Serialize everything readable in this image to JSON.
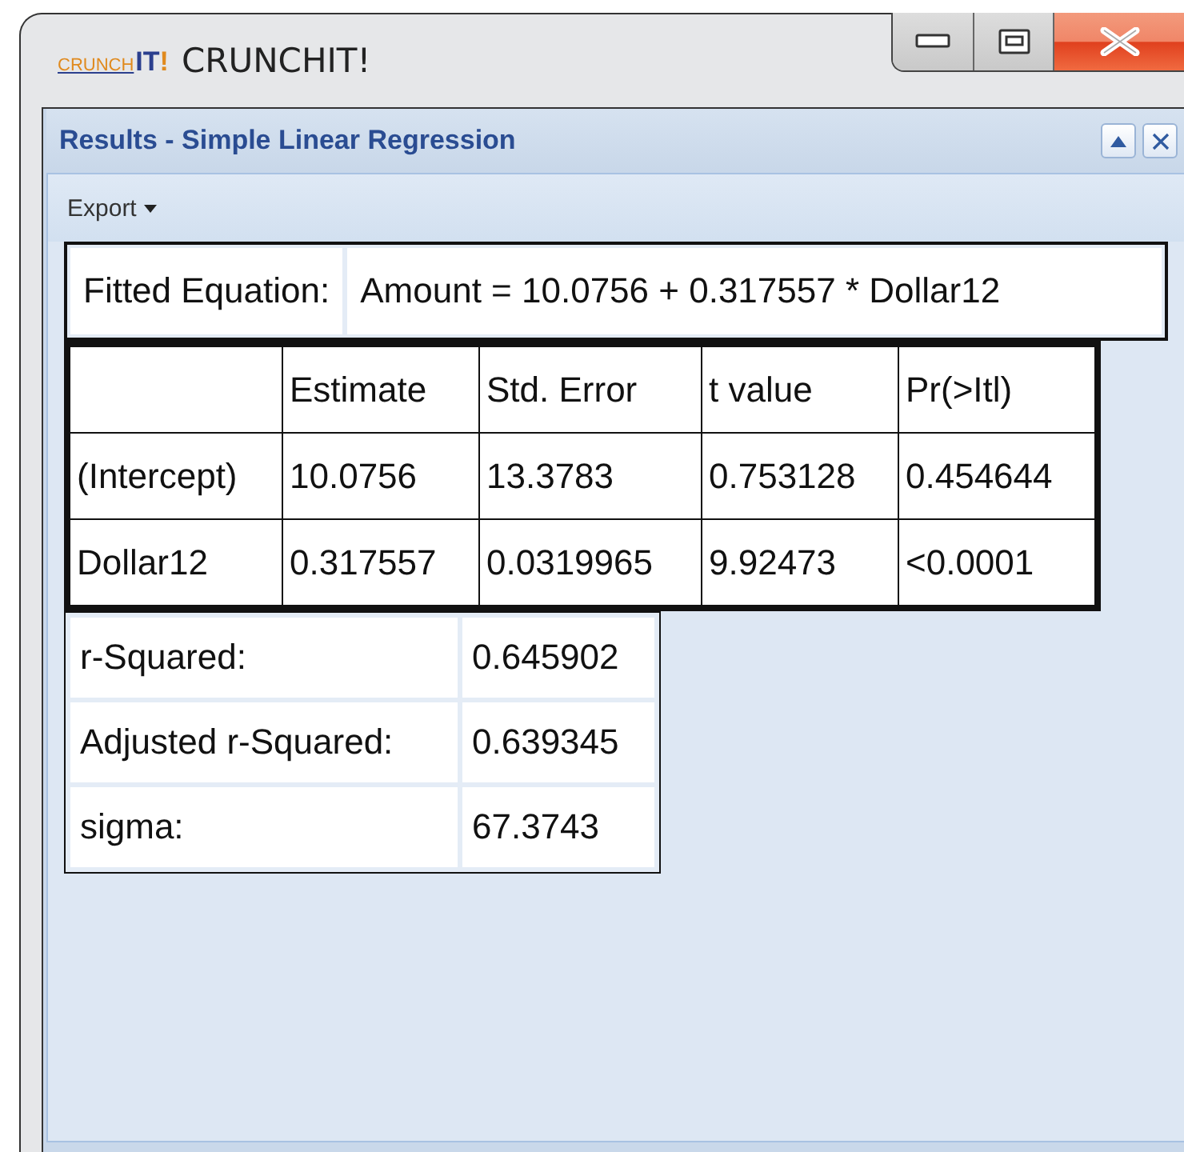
{
  "window": {
    "logo": {
      "left": "CRUNCH",
      "right": "IT",
      "mark": "!"
    },
    "title": "CRUNCHIT!",
    "controls": [
      {
        "kind": "minimize"
      },
      {
        "kind": "maximize"
      },
      {
        "kind": "close"
      }
    ]
  },
  "panel": {
    "title": "Results - Simple Linear Regression",
    "controls": [
      {
        "kind": "collapse"
      },
      {
        "kind": "close"
      }
    ],
    "toolbar": {
      "menu": "Export"
    }
  },
  "equation": {
    "label": "Fitted Equation:",
    "value": "Amount = 10.0756 + 0.317557 * Dollar12"
  },
  "coefficients": {
    "columns": [
      "Estimate",
      "Std. Error",
      "t value",
      "Pr(>Itl)"
    ],
    "rows": [
      {
        "term": "(Intercept)",
        "cells": [
          "10.0756",
          "13.3783",
          "0.753128",
          "0.454644"
        ]
      },
      {
        "term": "Dollar12",
        "cells": [
          "0.317557",
          "0.0319965",
          "9.92473",
          "<0.0001"
        ]
      }
    ]
  },
  "statistics": [
    {
      "label": "r-Squared:",
      "value": "0.645902"
    },
    {
      "label": "Adjusted r-Squared:",
      "value": "0.639345"
    },
    {
      "label": "sigma:",
      "value": "67.3743"
    }
  ]
}
